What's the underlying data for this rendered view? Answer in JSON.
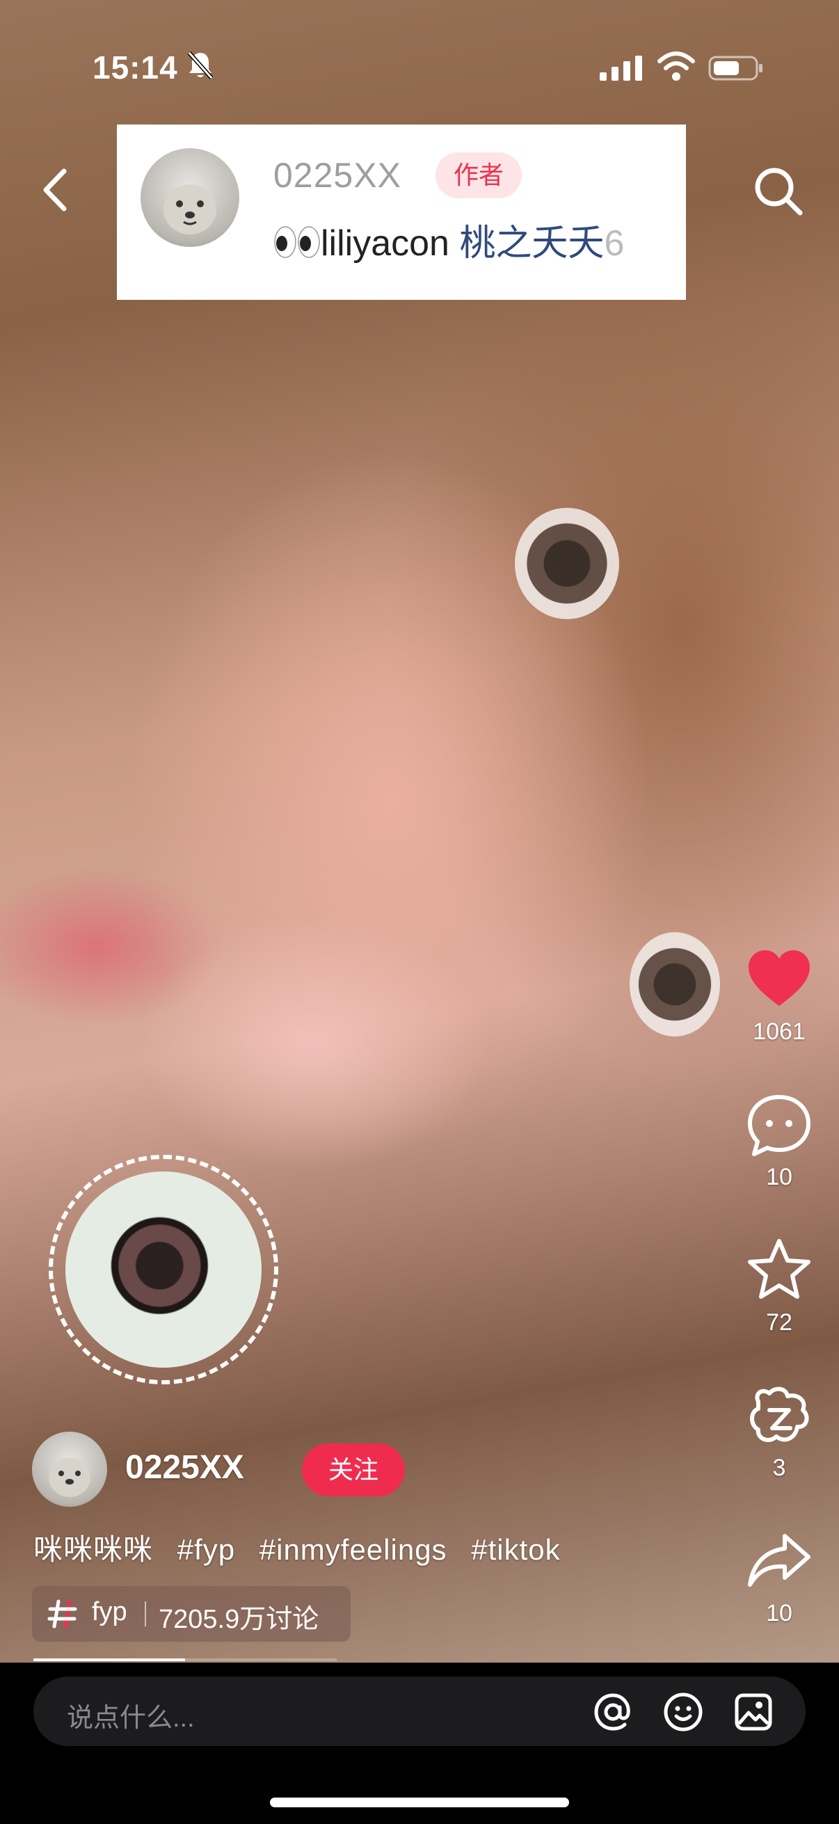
{
  "status_bar": {
    "time": "15:14"
  },
  "comment_card": {
    "author": "0225XX",
    "badge": "作者",
    "text_user": "liliyacon",
    "text_tag": "桃之夭夭",
    "text_more": "6"
  },
  "actions": [
    {
      "icon": "heart-icon",
      "count": "1061",
      "color": "#f0304f"
    },
    {
      "icon": "comment-icon",
      "count": "10"
    },
    {
      "icon": "star-icon",
      "count": "72"
    },
    {
      "icon": "duet-icon",
      "count": "3"
    },
    {
      "icon": "share-icon",
      "count": "10"
    }
  ],
  "author": {
    "name": "0225XX",
    "follow_label": "关注"
  },
  "caption": {
    "text": "咪咪咪咪",
    "hashtags": [
      "#fyp",
      "#inmyfeelings",
      "#tiktok"
    ]
  },
  "topic": {
    "name": "fyp",
    "count": "7205.9万讨论"
  },
  "playback": {
    "progress": 0.5
  },
  "input": {
    "placeholder": "说点什么..."
  },
  "colors": {
    "accent": "#f02c4e",
    "background": "#000000"
  }
}
